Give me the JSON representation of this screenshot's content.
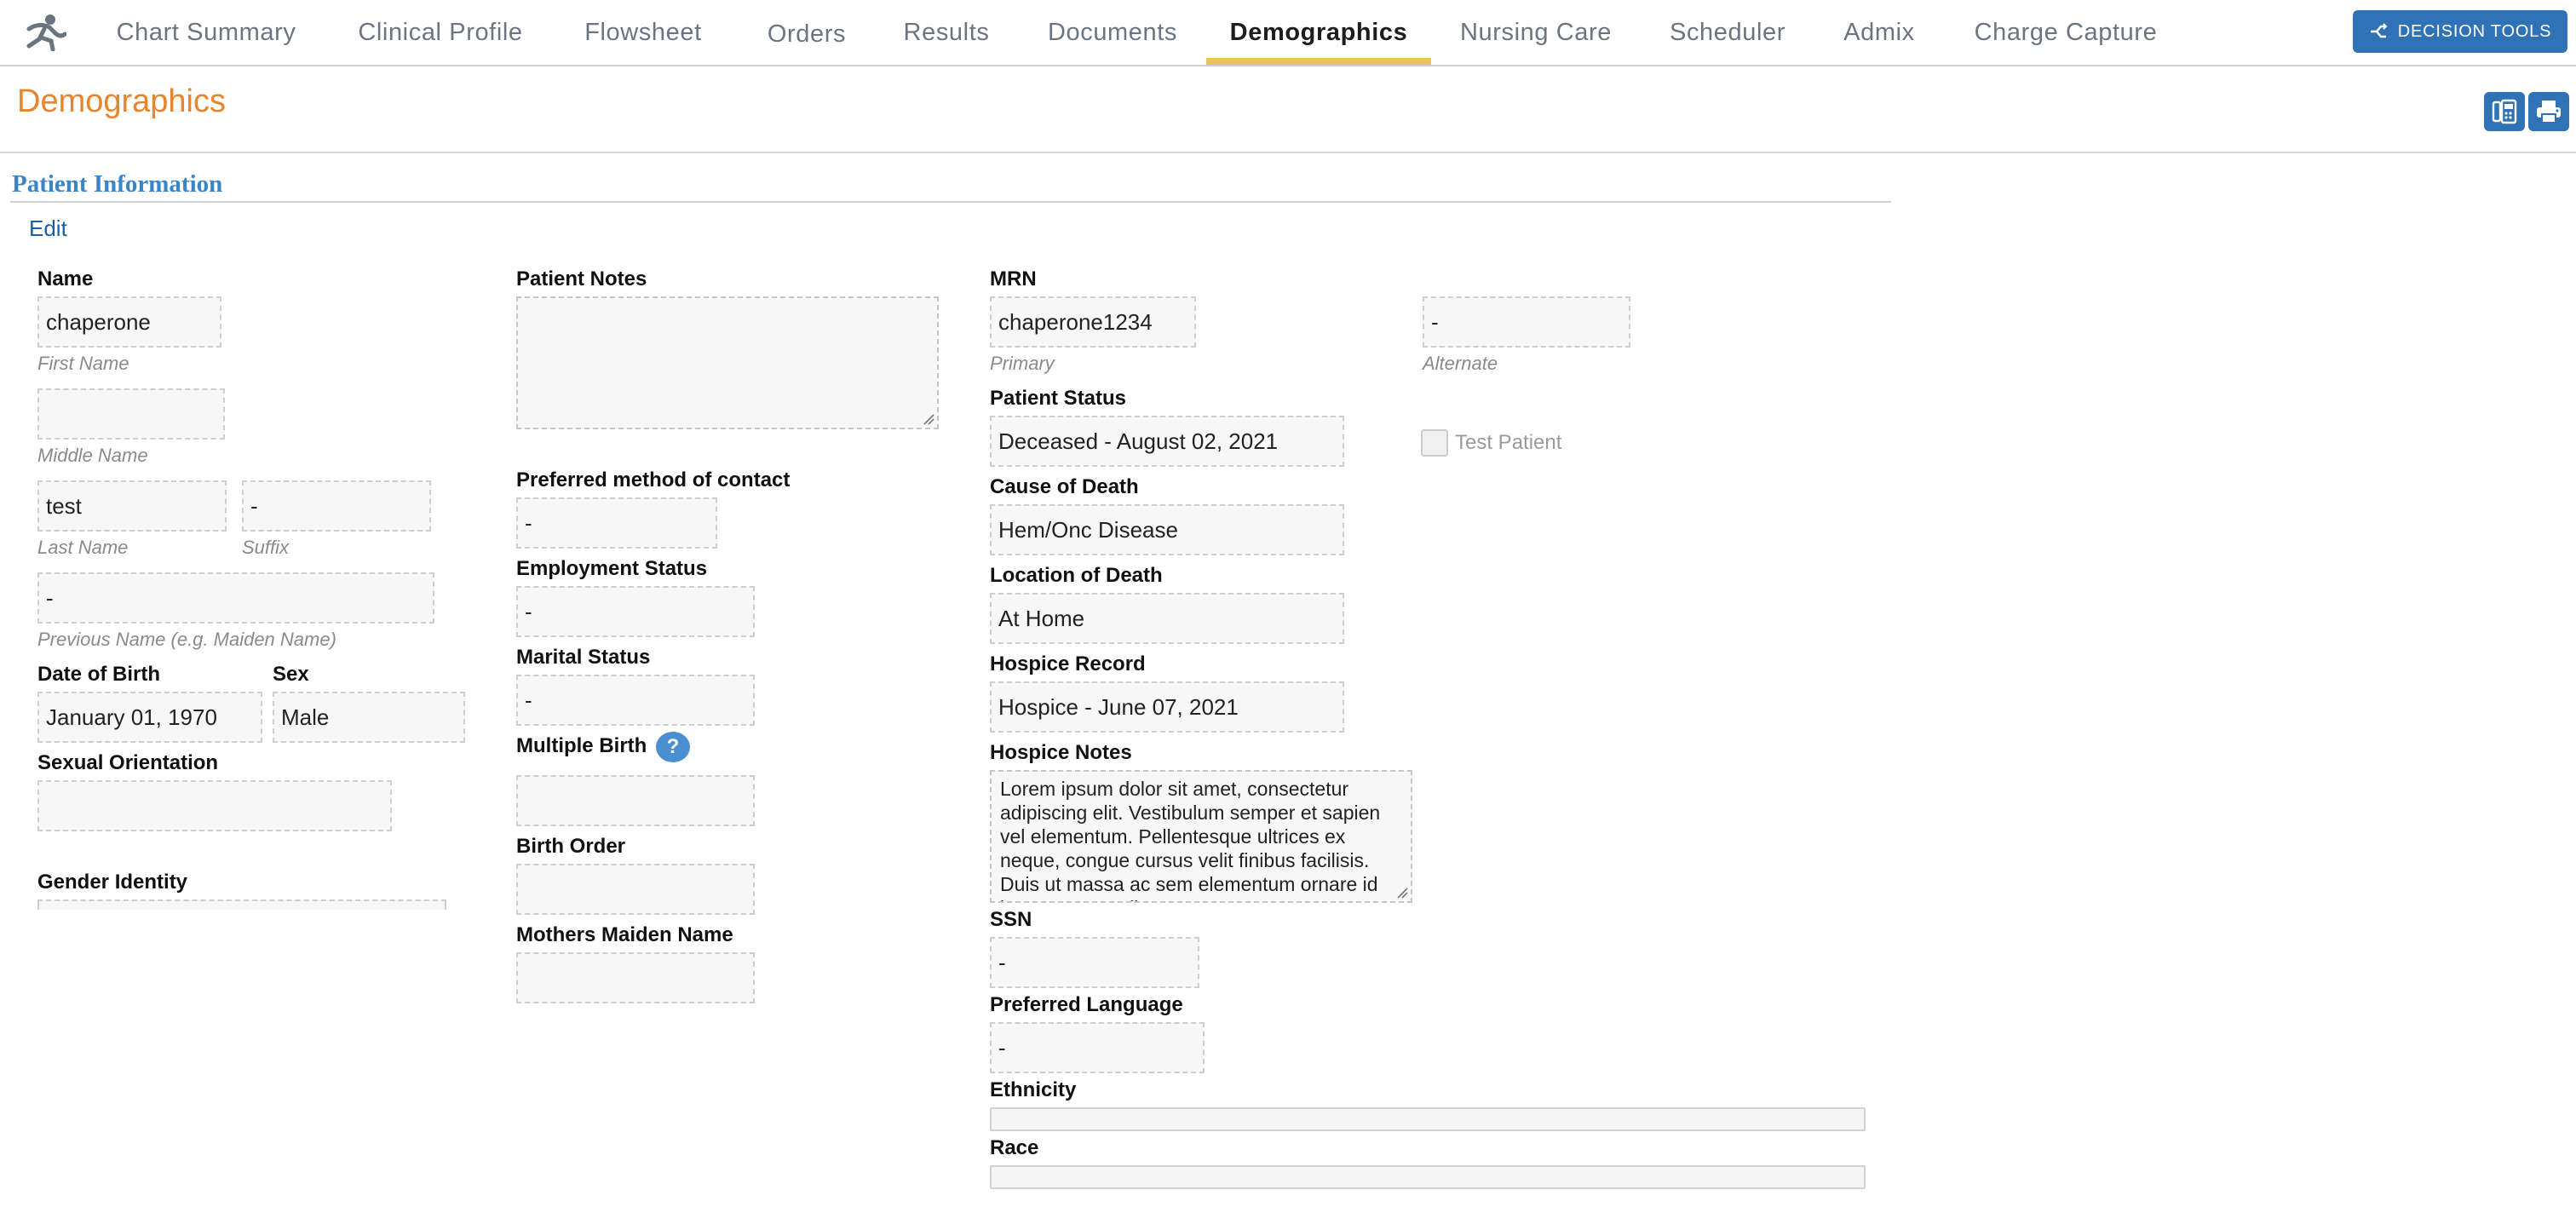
{
  "nav": {
    "tabs": [
      {
        "label": "Chart Summary"
      },
      {
        "label": "Clinical Profile"
      },
      {
        "label": "Flowsheet"
      },
      {
        "label": "Orders"
      },
      {
        "label": "Results"
      },
      {
        "label": "Documents"
      },
      {
        "label": "Demographics"
      },
      {
        "label": "Nursing Care"
      },
      {
        "label": "Scheduler"
      },
      {
        "label": "Admix"
      },
      {
        "label": "Charge Capture"
      }
    ],
    "active_tab": "Demographics",
    "decision_tools_label": "DECISION TOOLS"
  },
  "page": {
    "title": "Demographics",
    "section_title": "Patient Information",
    "edit_label": "Edit"
  },
  "name": {
    "label": "Name",
    "first_value": "chaperone",
    "first_caption": "First Name",
    "middle_value": "",
    "middle_caption": "Middle Name",
    "last_value": "test",
    "last_caption": "Last Name",
    "suffix_value": "-",
    "suffix_caption": "Suffix",
    "previous_value": "-",
    "previous_caption": "Previous Name (e.g. Maiden Name)"
  },
  "dob": {
    "label": "Date of Birth",
    "value": "January 01, 1970"
  },
  "sex": {
    "label": "Sex",
    "value": "Male"
  },
  "sexual_orientation": {
    "label": "Sexual Orientation",
    "value": ""
  },
  "gender_identity": {
    "label": "Gender Identity",
    "value": ""
  },
  "patient_notes": {
    "label": "Patient Notes",
    "value": ""
  },
  "preferred_contact": {
    "label": "Preferred method of contact",
    "value": "-"
  },
  "employment_status": {
    "label": "Employment Status",
    "value": "-"
  },
  "marital_status": {
    "label": "Marital Status",
    "value": "-"
  },
  "multiple_birth": {
    "label": "Multiple Birth",
    "value": "",
    "help": "?"
  },
  "birth_order": {
    "label": "Birth Order",
    "value": ""
  },
  "mothers_maiden_name": {
    "label": "Mothers Maiden Name",
    "value": ""
  },
  "mrn": {
    "label": "MRN",
    "primary_value": "chaperone1234",
    "primary_caption": "Primary",
    "alternate_value": "-",
    "alternate_caption": "Alternate"
  },
  "patient_status": {
    "label": "Patient Status",
    "value": "Deceased - August 02, 2021"
  },
  "test_patient": {
    "label": "Test Patient",
    "checked": false
  },
  "cause_of_death": {
    "label": "Cause of Death",
    "value": "Hem/Onc Disease"
  },
  "location_of_death": {
    "label": "Location of Death",
    "value": "At Home"
  },
  "hospice_record": {
    "label": "Hospice Record",
    "value": "Hospice - June 07, 2021"
  },
  "hospice_notes": {
    "label": "Hospice Notes",
    "value": "Lorem ipsum dolor sit amet, consectetur adipiscing elit. Vestibulum semper et sapien vel elementum. Pellentesque ultrices ex neque, congue cursus velit finibus facilisis. Duis ut massa ac sem elementum ornare id lacus. Suspendisse cursus erat."
  },
  "ssn": {
    "label": "SSN",
    "value": "-"
  },
  "preferred_language": {
    "label": "Preferred Language",
    "value": "-"
  },
  "ethnicity": {
    "label": "Ethnicity",
    "value": ""
  },
  "race": {
    "label": "Race",
    "value": ""
  },
  "colors": {
    "accent_orange": "#e8842a",
    "primary_blue": "#2f72b5",
    "section_blue": "#3a84c9",
    "active_underline": "#e9c45a"
  }
}
